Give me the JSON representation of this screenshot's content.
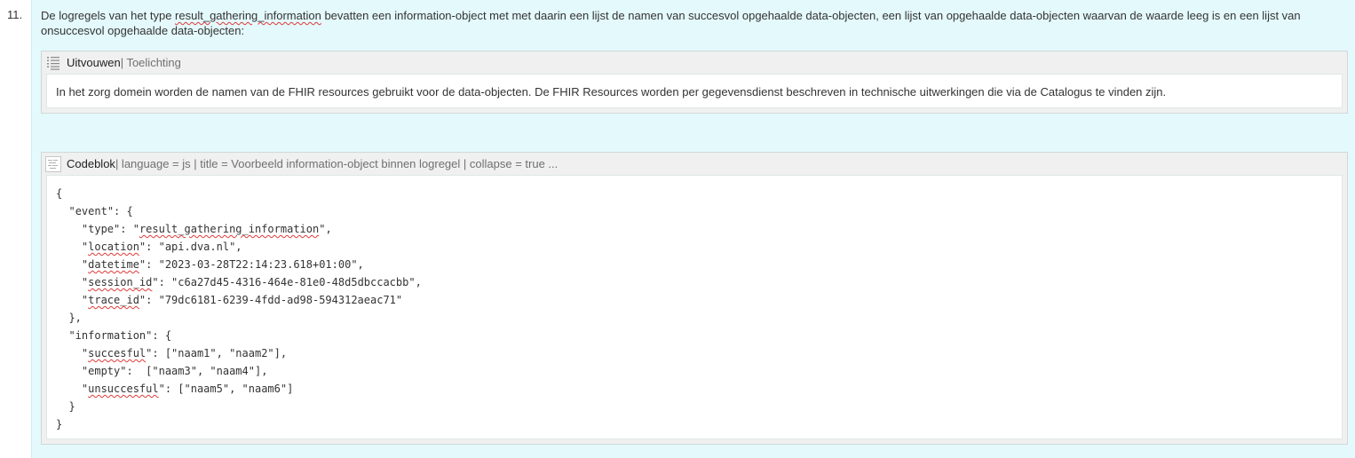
{
  "list_item": {
    "number": "11."
  },
  "paragraph": {
    "part1": "De logregels van het type ",
    "type_name": "result_gathering_information",
    "part2": " bevatten een information-object met met daarin een lijst de namen van succesvol opgehaalde data-objecten, een lijst van opgehaalde data-objecten waarvan de waarde leeg is en een lijst van onsuccesvol opgehaalde data-objecten:"
  },
  "expand_macro": {
    "icon": "list-lines-icon",
    "title": "Uitvouwen",
    "params": " | Toelichting",
    "body": "In het zorg domein worden de namen van de FHIR resources gebruikt voor de data-objecten. De FHIR Resources worden per gegevensdienst beschreven in technische uitwerkingen die via de Catalogus te vinden zijn."
  },
  "code_macro": {
    "icon": "code-snippet-icon",
    "title": "Codeblok",
    "params": " | language = js | title = Voorbeeld information-object binnen logregel | collapse = true ...",
    "lines": [
      [
        {
          "t": "{"
        }
      ],
      [
        {
          "t": "  \""
        },
        {
          "t": "event",
          "s": false
        },
        {
          "t": "\": {"
        }
      ],
      [
        {
          "t": "    \""
        },
        {
          "t": "type"
        },
        {
          "t": "\": \""
        },
        {
          "t": "result_gathering_information",
          "s": true
        },
        {
          "t": "\","
        }
      ],
      [
        {
          "t": "    \""
        },
        {
          "t": "location",
          "s": true
        },
        {
          "t": "\": \"api.dva.nl\","
        }
      ],
      [
        {
          "t": "    \""
        },
        {
          "t": "datetime",
          "s": true
        },
        {
          "t": "\": \"2023-03-28T22:14:23.618+01:00\","
        }
      ],
      [
        {
          "t": "    \""
        },
        {
          "t": "session_id",
          "s": true
        },
        {
          "t": "\": \"c6a27d45-4316-464e-81e0-48d5dbccacbb\","
        }
      ],
      [
        {
          "t": "    \""
        },
        {
          "t": "trace_id",
          "s": true
        },
        {
          "t": "\": \"79dc6181-6239-4fdd-ad98-594312aeac71\""
        }
      ],
      [
        {
          "t": "  },"
        }
      ],
      [
        {
          "t": "  \"information\": {"
        }
      ],
      [
        {
          "t": "    \""
        },
        {
          "t": "succesful",
          "s": true
        },
        {
          "t": "\": [\"naam1\", \"naam2\"],"
        }
      ],
      [
        {
          "t": "    \"empty\":  [\"naam3\", \"naam4\"],"
        }
      ],
      [
        {
          "t": "    \""
        },
        {
          "t": "unsuccesful",
          "s": true
        },
        {
          "t": "\": [\"naam5\", \"naam6\"]"
        }
      ],
      [
        {
          "t": "  }"
        }
      ],
      [
        {
          "t": "}"
        }
      ]
    ]
  },
  "colors": {
    "panel_bg": "#e4f9fc",
    "macro_bg": "#f0f0f0",
    "spellcheck": "#e03a3a"
  }
}
